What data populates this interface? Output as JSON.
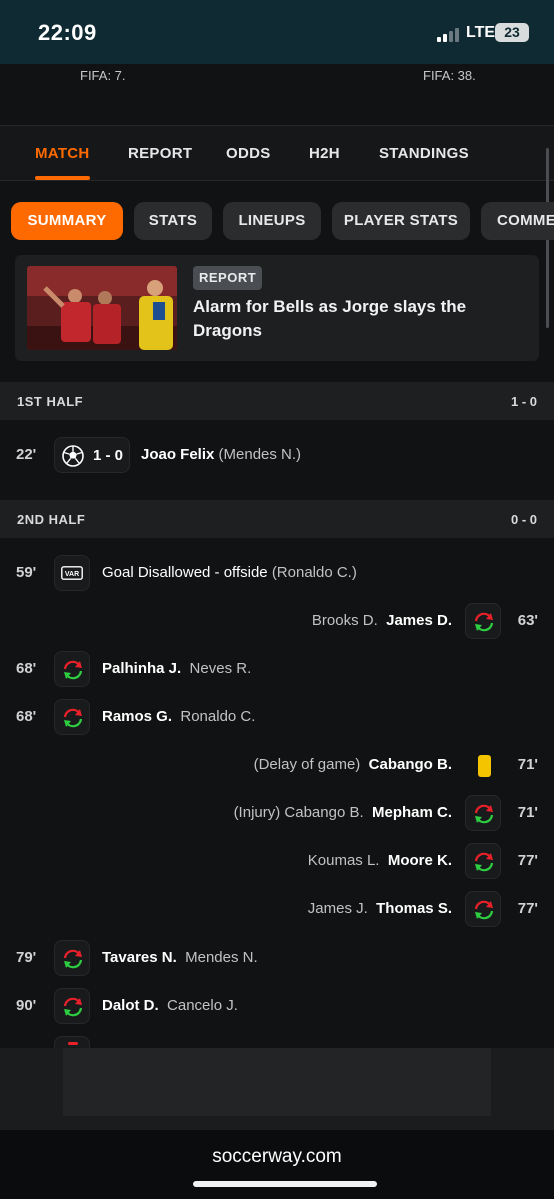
{
  "status_bar": {
    "time": "22:09",
    "network": "LTE",
    "battery": "23"
  },
  "fifa": {
    "home": "FIFA: 7.",
    "away": "FIFA: 38."
  },
  "main_tabs": [
    {
      "label": "MATCH",
      "active": true
    },
    {
      "label": "REPORT"
    },
    {
      "label": "ODDS"
    },
    {
      "label": "H2H"
    },
    {
      "label": "STANDINGS"
    }
  ],
  "sub_tabs": [
    {
      "label": "SUMMARY",
      "active": true
    },
    {
      "label": "STATS"
    },
    {
      "label": "LINEUPS"
    },
    {
      "label": "PLAYER STATS"
    },
    {
      "label": "COMME"
    }
  ],
  "report": {
    "badge": "REPORT",
    "title": "Alarm for Bells as Jorge slays the Dragons"
  },
  "first_half": {
    "label": "1ST HALF",
    "score": "1 - 0",
    "events": [
      {
        "minute": "22'",
        "icon": "soccer-ball-icon",
        "score": "1 - 0",
        "player": "Joao Felix",
        "detail": "(Mendes N.)"
      }
    ]
  },
  "second_half": {
    "label": "2ND HALF",
    "score": "0 - 0",
    "events": [
      {
        "minute": "59'",
        "icon": "var-icon",
        "text": "Goal Disallowed - offside",
        "detail": "(Ronaldo C.)"
      },
      {
        "minute": "63'",
        "icon": "substitution-icon",
        "player": "James D.",
        "detail": "Brooks D."
      },
      {
        "minute": "68'",
        "icon": "substitution-icon",
        "player": "Palhinha J.",
        "detail": "Neves R."
      },
      {
        "minute": "68'",
        "icon": "substitution-icon",
        "player": "Ramos G.",
        "detail": "Ronaldo C."
      },
      {
        "minute": "71'",
        "icon": "yellow-card-icon",
        "player": "Cabango B.",
        "detail": "(Delay of game)"
      },
      {
        "minute": "71'",
        "icon": "substitution-icon",
        "player": "Mepham C.",
        "detail": "(Injury) Cabango B."
      },
      {
        "minute": "77'",
        "icon": "substitution-icon",
        "player": "Moore K.",
        "detail": "Koumas L."
      },
      {
        "minute": "77'",
        "icon": "substitution-icon",
        "player": "Thomas S.",
        "detail": "James J."
      },
      {
        "minute": "79'",
        "icon": "substitution-icon",
        "player": "Tavares N.",
        "detail": "Mendes N."
      },
      {
        "minute": "90'",
        "icon": "substitution-icon",
        "player": "Dalot D.",
        "detail": "Cancelo J."
      }
    ]
  },
  "colors": {
    "accent": "#ff6a00",
    "sub_in": "#2ecc40",
    "sub_out": "#e8212b",
    "yellow_card": "#f5c400"
  },
  "footer": {
    "url": "soccerway.com"
  }
}
